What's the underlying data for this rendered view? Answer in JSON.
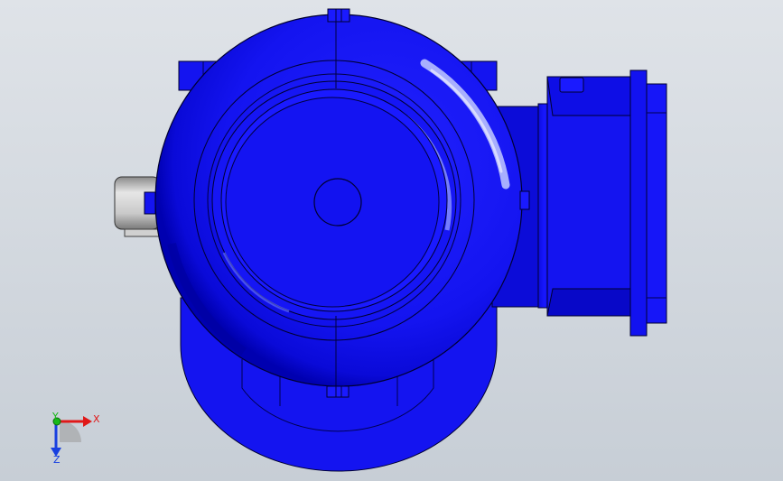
{
  "viewport": {
    "background_top": "#dfe3e8",
    "background_bottom": "#c7ced6"
  },
  "model": {
    "body_color": "#1212f2",
    "dark_color": "#0000c8",
    "edge_color": "#000030",
    "highlight_color": "#aab4ff",
    "boss_color": "#c9c9c9"
  },
  "triad": {
    "x_label": "X",
    "y_label": "Y",
    "z_label": "Z",
    "x_color": "#e01818",
    "y_color": "#18b818",
    "z_color": "#1840e0"
  }
}
